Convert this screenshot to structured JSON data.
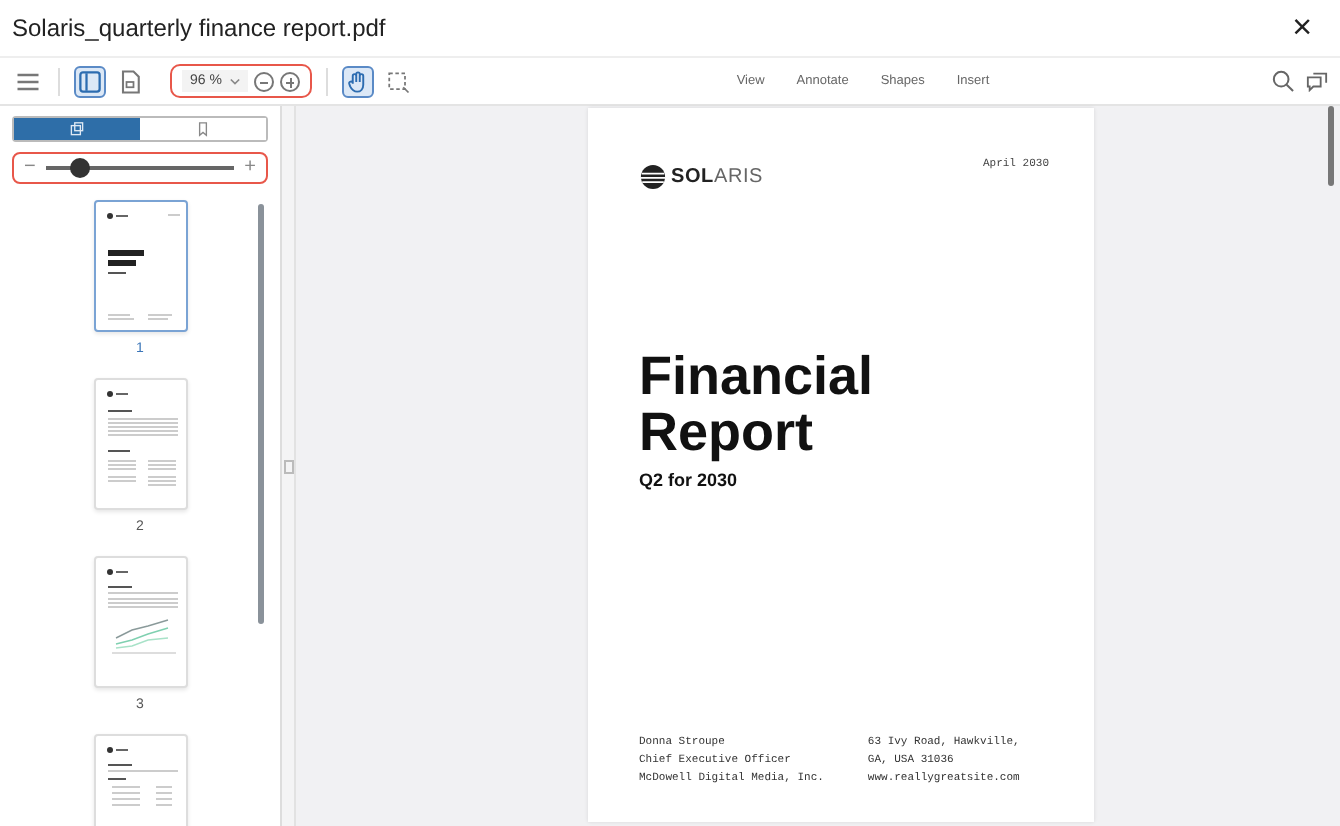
{
  "window": {
    "title": "Solaris_quarterly finance report.pdf",
    "close": "×"
  },
  "toolbar": {
    "left_tools": [
      {
        "kind": "menu",
        "selected": false
      },
      {
        "kind": "sidebar",
        "selected": true
      },
      {
        "kind": "page",
        "selected": false
      }
    ],
    "zoom": {
      "value": "96 %"
    },
    "tools": [
      {
        "kind": "hand",
        "selected": true
      },
      {
        "kind": "select",
        "selected": false
      }
    ],
    "menu": [
      "View",
      "Annotate",
      "Shapes",
      "Insert"
    ]
  },
  "sidebar": {
    "tabs": [
      {
        "kind": "thumbnails",
        "selected": true
      },
      {
        "kind": "bookmarks",
        "selected": false
      }
    ],
    "size_slider": {
      "minus": "−",
      "plus": "+",
      "level": 0.18
    },
    "thumbnails": [
      {
        "kind": "cover",
        "label": "1",
        "selected": true
      },
      {
        "kind": "text",
        "label": "2",
        "selected": false
      },
      {
        "kind": "chart",
        "label": "3",
        "selected": false
      },
      {
        "kind": "table",
        "selected": false
      }
    ]
  },
  "page": {
    "logo": {
      "bold": "SOL",
      "light": "ARIS"
    },
    "date": "April 2030",
    "title": "Financial Report",
    "subtitle": "Q2 for 2030",
    "footer_left": [
      "Donna Stroupe",
      "Chief Executive Officer",
      "McDowell Digital Media, Inc."
    ],
    "footer_right": [
      "63 Ivy Road, Hawkville,",
      "GA, USA 31036",
      "www.reallygreatsite.com"
    ]
  }
}
